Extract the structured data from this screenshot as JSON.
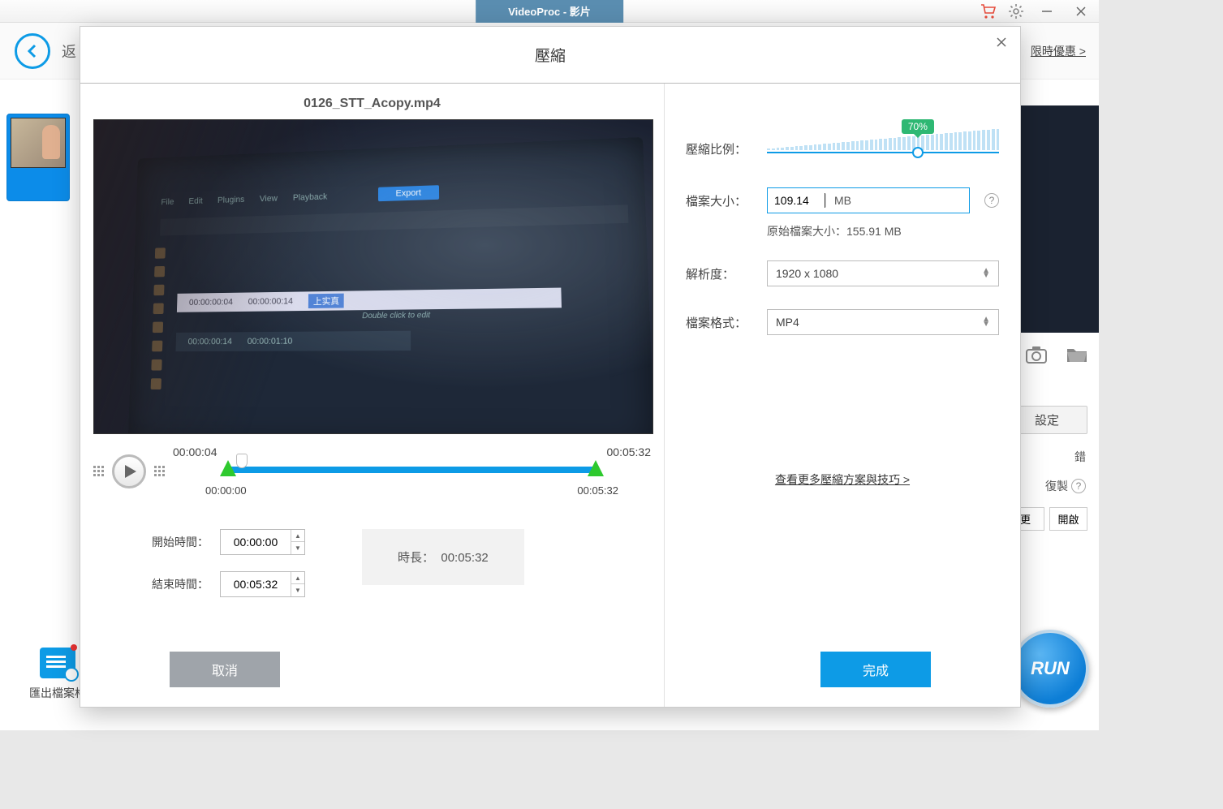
{
  "titlebar": {
    "title": "VideoProc - 影片"
  },
  "backbar": {
    "label": "返",
    "promo": "限時優惠 >"
  },
  "modal": {
    "title": "壓縮",
    "filename": "0126_STT_Acopy.mp4",
    "preview_menu": [
      "File",
      "Edit",
      "Plugins",
      "View",
      "Playback"
    ],
    "preview_export": "Export",
    "preview_row1_time1": "00:00:00:04",
    "preview_row1_time2": "00:00:00:14",
    "preview_row1_tag": "上实真",
    "preview_hint": "Double click to edit",
    "preview_row2_time1": "00:00:00:14",
    "preview_row2_time2": "00:00:01:10",
    "timeline": {
      "current": "00:00:04",
      "end_top": "00:05:32",
      "start_bottom": "00:00:00",
      "end_bottom": "00:05:32"
    },
    "start_label": "開始時間：",
    "start_value": "00:00:00",
    "end_label": "結束時間：",
    "end_value": "00:05:32",
    "duration_label": "時長：",
    "duration_value": "00:05:32",
    "cancel": "取消",
    "done": "完成"
  },
  "right": {
    "ratio_label": "壓縮比例：",
    "ratio_badge": "70%",
    "size_label": "檔案大小：",
    "size_value": "109.14",
    "size_unit": "MB",
    "orig_size": "原始檔案大小：155.91 MB",
    "resolution_label": "解析度：",
    "resolution_value": "1920 x 1080",
    "format_label": "檔案格式：",
    "format_value": "MP4",
    "more_link": "查看更多壓縮方案與技巧 >"
  },
  "sidepanel": {
    "settings": "設定",
    "crop": "錯",
    "copy": "復製",
    "row1a": "更",
    "row1b": "開啟"
  },
  "export": {
    "label": "匯出檔案格"
  },
  "run": "RUN"
}
